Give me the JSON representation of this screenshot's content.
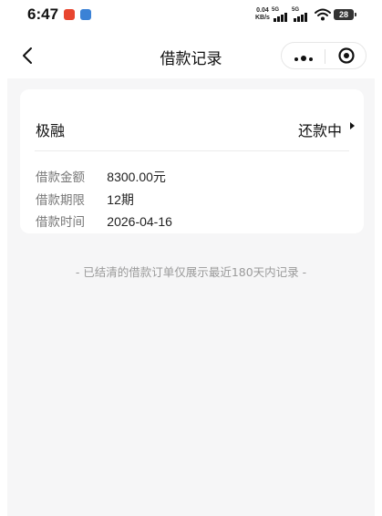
{
  "status_bar": {
    "time": "6:47",
    "net_speed_value": "0.04",
    "net_speed_unit": "KB/s",
    "signal_1_label": "5G",
    "signal_2_label": "5G",
    "battery": "28"
  },
  "nav": {
    "title": "借款记录"
  },
  "loan": {
    "lender": "极融",
    "status": "还款中",
    "fields": [
      {
        "label": "借款金额",
        "value": "8300.00元"
      },
      {
        "label": "借款期限",
        "value": "12期"
      },
      {
        "label": "借款时间",
        "value": "2026-04-16"
      }
    ]
  },
  "footnote": "- 已结清的借款订单仅展示最近180天内记录 -",
  "colors": {
    "page_bg": "#f6f6f7",
    "card_bg": "#ffffff",
    "muted_text": "#777777"
  }
}
